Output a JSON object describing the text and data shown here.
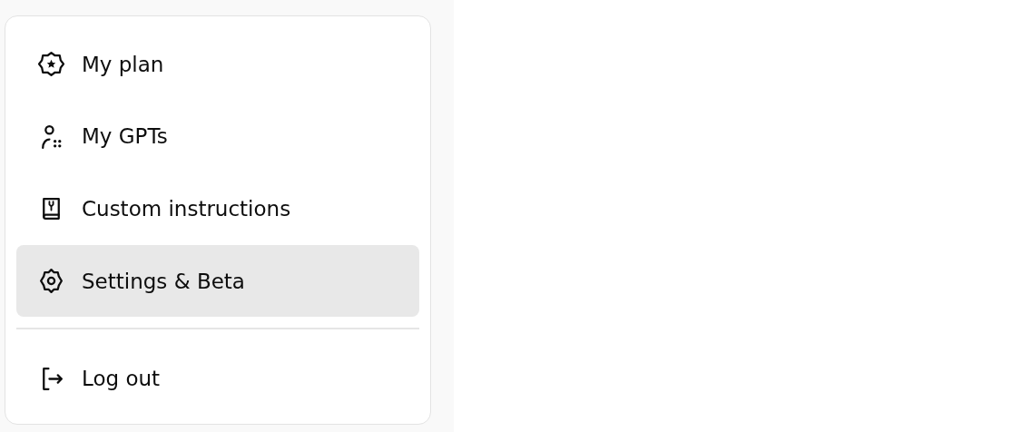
{
  "menu": {
    "items": [
      {
        "kind": "plan",
        "label": "My plan",
        "selected": false
      },
      {
        "kind": "gpts",
        "label": "My GPTs",
        "selected": false
      },
      {
        "kind": "instructions",
        "label": "Custom instructions",
        "selected": false
      },
      {
        "kind": "settings",
        "label": "Settings & Beta",
        "selected": true
      }
    ],
    "footer_items": [
      {
        "kind": "logout",
        "label": "Log out",
        "selected": false
      }
    ]
  }
}
